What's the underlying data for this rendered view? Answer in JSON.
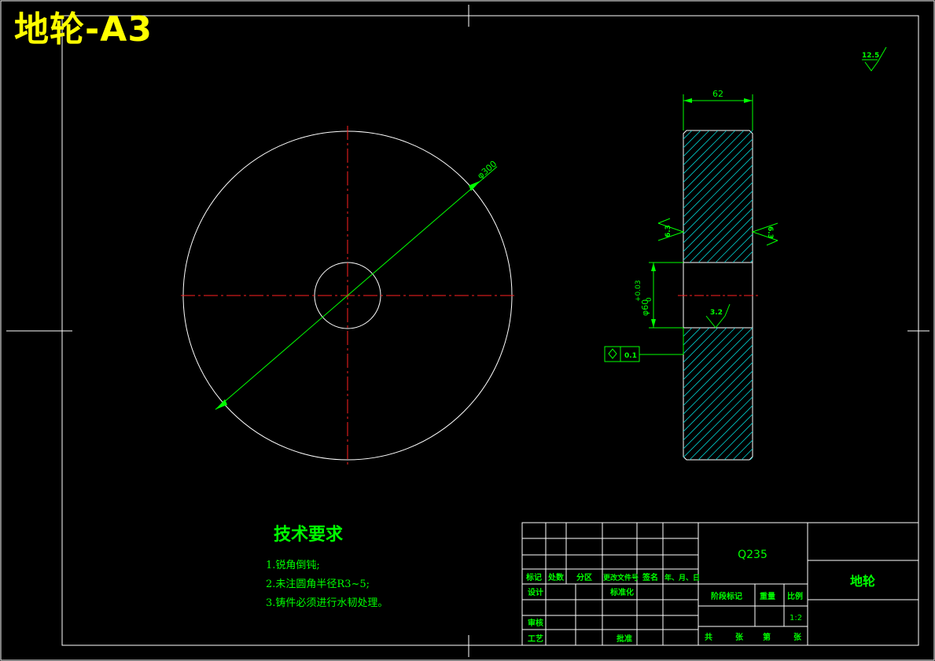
{
  "title": "地轮-A3",
  "colors": {
    "background": "#000000",
    "border": "#ffffff",
    "dimension": "#00ff00",
    "centerline": "#ff2020",
    "hatch": "#00c8c8",
    "title": "#ffff00"
  },
  "drawing": {
    "diameter_label": "φ300",
    "width_label": "62",
    "bore_label": "φ60",
    "bore_tol_upper": "+0.03",
    "bore_tol_lower": "0",
    "roughness_general": "12.5",
    "roughness_left": "6.3",
    "roughness_right": "6.3",
    "roughness_bore": "3.2",
    "tolerance_value": "0.1"
  },
  "notes": {
    "heading": "技术要求",
    "items": [
      "1.锐角倒钝;",
      "2.未注圆角半径R3~5;",
      "3.铸件必须进行水韧处理。"
    ]
  },
  "title_block": {
    "material": "Q235",
    "part_name": "地轮",
    "scale": "1:2",
    "row_labels": [
      "标记",
      "处数",
      "分区",
      "更改文件号",
      "签名",
      "年、月、日"
    ],
    "design": "设计",
    "standardization": "标准化",
    "review": "审核",
    "process": "工艺",
    "approve": "批准",
    "stage_mark": "阶段标记",
    "weight": "重量",
    "scale_label": "比例",
    "sheet_total": "共",
    "sheet_unit1": "张",
    "sheet_num": "第",
    "sheet_unit2": "张"
  }
}
